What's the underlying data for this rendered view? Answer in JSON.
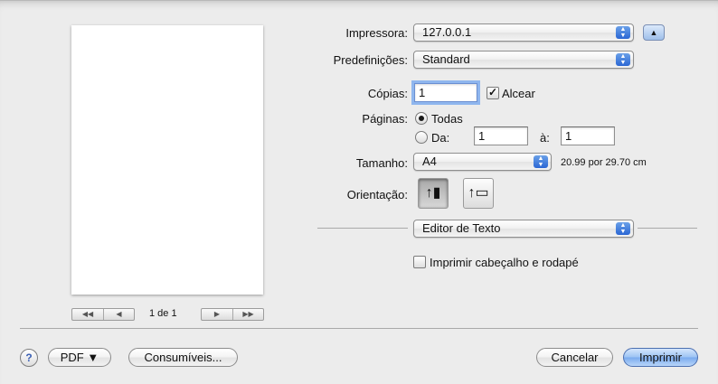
{
  "preview": {
    "page_count": "1 de 1",
    "pager_left": [
      "◀◀",
      "◀"
    ],
    "pager_right": [
      "▶",
      "▶▶"
    ]
  },
  "printer": {
    "label": "Impressora:",
    "value": "127.0.0.1"
  },
  "presets": {
    "label": "Predefinições:",
    "value": "Standard"
  },
  "copies": {
    "label": "Cópias:",
    "value": "1",
    "collate_label": "Alcear",
    "collate_checked": true
  },
  "pages": {
    "label": "Páginas:",
    "all_label": "Todas",
    "range_label": "Da:",
    "from": "1",
    "to_label": "à:",
    "to": "1",
    "selected": "all"
  },
  "size": {
    "label": "Tamanho:",
    "value": "A4",
    "dimensions": "20.99 por 29.70 cm"
  },
  "orientation": {
    "label": "Orientação:",
    "options": [
      "portrait",
      "landscape"
    ],
    "selected": "portrait"
  },
  "section": {
    "value": "Editor de Texto"
  },
  "header_footer": {
    "label": "Imprimir cabeçalho e rodapé",
    "checked": false
  },
  "buttons": {
    "help": "?",
    "pdf": "PDF ▼",
    "supplies": "Consumíveis...",
    "cancel": "Cancelar",
    "print": "Imprimir"
  },
  "colors": {
    "accent": "#79aaee",
    "background": "#ececec"
  }
}
